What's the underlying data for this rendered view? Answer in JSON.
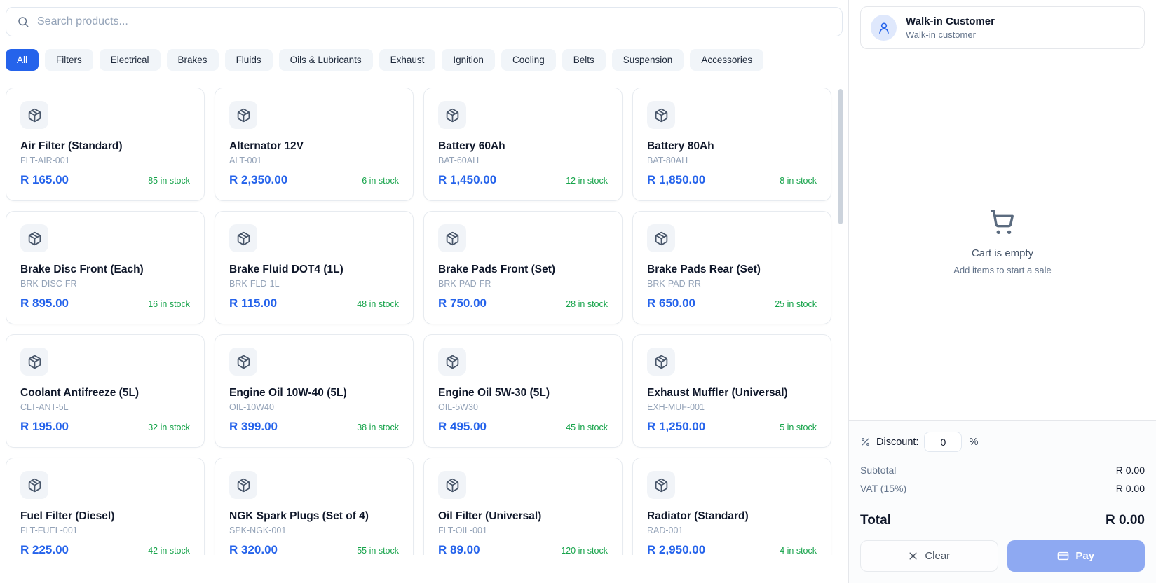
{
  "search": {
    "placeholder": "Search products..."
  },
  "categories": [
    {
      "label": "All",
      "active": true
    },
    {
      "label": "Filters",
      "active": false
    },
    {
      "label": "Electrical",
      "active": false
    },
    {
      "label": "Brakes",
      "active": false
    },
    {
      "label": "Fluids",
      "active": false
    },
    {
      "label": "Oils & Lubricants",
      "active": false
    },
    {
      "label": "Exhaust",
      "active": false
    },
    {
      "label": "Ignition",
      "active": false
    },
    {
      "label": "Cooling",
      "active": false
    },
    {
      "label": "Belts",
      "active": false
    },
    {
      "label": "Suspension",
      "active": false
    },
    {
      "label": "Accessories",
      "active": false
    }
  ],
  "products": [
    {
      "name": "Air Filter (Standard)",
      "sku": "FLT-AIR-001",
      "price": "R 165.00",
      "stock": "85 in stock"
    },
    {
      "name": "Alternator 12V",
      "sku": "ALT-001",
      "price": "R 2,350.00",
      "stock": "6 in stock"
    },
    {
      "name": "Battery 60Ah",
      "sku": "BAT-60AH",
      "price": "R 1,450.00",
      "stock": "12 in stock"
    },
    {
      "name": "Battery 80Ah",
      "sku": "BAT-80AH",
      "price": "R 1,850.00",
      "stock": "8 in stock"
    },
    {
      "name": "Brake Disc Front (Each)",
      "sku": "BRK-DISC-FR",
      "price": "R 895.00",
      "stock": "16 in stock"
    },
    {
      "name": "Brake Fluid DOT4 (1L)",
      "sku": "BRK-FLD-1L",
      "price": "R 115.00",
      "stock": "48 in stock"
    },
    {
      "name": "Brake Pads Front (Set)",
      "sku": "BRK-PAD-FR",
      "price": "R 750.00",
      "stock": "28 in stock"
    },
    {
      "name": "Brake Pads Rear (Set)",
      "sku": "BRK-PAD-RR",
      "price": "R 650.00",
      "stock": "25 in stock"
    },
    {
      "name": "Coolant Antifreeze (5L)",
      "sku": "CLT-ANT-5L",
      "price": "R 195.00",
      "stock": "32 in stock"
    },
    {
      "name": "Engine Oil 10W-40 (5L)",
      "sku": "OIL-10W40",
      "price": "R 399.00",
      "stock": "38 in stock"
    },
    {
      "name": "Engine Oil 5W-30 (5L)",
      "sku": "OIL-5W30",
      "price": "R 495.00",
      "stock": "45 in stock"
    },
    {
      "name": "Exhaust Muffler (Universal)",
      "sku": "EXH-MUF-001",
      "price": "R 1,250.00",
      "stock": "5 in stock"
    },
    {
      "name": "Fuel Filter (Diesel)",
      "sku": "FLT-FUEL-001",
      "price": "R 225.00",
      "stock": "42 in stock"
    },
    {
      "name": "NGK Spark Plugs (Set of 4)",
      "sku": "SPK-NGK-001",
      "price": "R 320.00",
      "stock": "55 in stock"
    },
    {
      "name": "Oil Filter (Universal)",
      "sku": "FLT-OIL-001",
      "price": "R 89.00",
      "stock": "120 in stock"
    },
    {
      "name": "Radiator (Standard)",
      "sku": "RAD-001",
      "price": "R 2,950.00",
      "stock": "4 in stock"
    }
  ],
  "customer": {
    "name": "Walk-in Customer",
    "type": "Walk-in customer"
  },
  "cart": {
    "empty_title": "Cart is empty",
    "empty_subtitle": "Add items to start a sale"
  },
  "summary": {
    "discount_label": "Discount:",
    "discount_value": "0",
    "discount_unit": "%",
    "rows": [
      {
        "label": "Subtotal",
        "value": "R 0.00"
      },
      {
        "label": "VAT (15%)",
        "value": "R 0.00"
      }
    ],
    "total_label": "Total",
    "total_value": "R 0.00",
    "clear_label": "Clear",
    "pay_label": "Pay"
  },
  "colors": {
    "accent": "#2563eb",
    "price": "#2563eb",
    "stock_green": "#16a34a",
    "pay_disabled": "#8ea9f2"
  }
}
